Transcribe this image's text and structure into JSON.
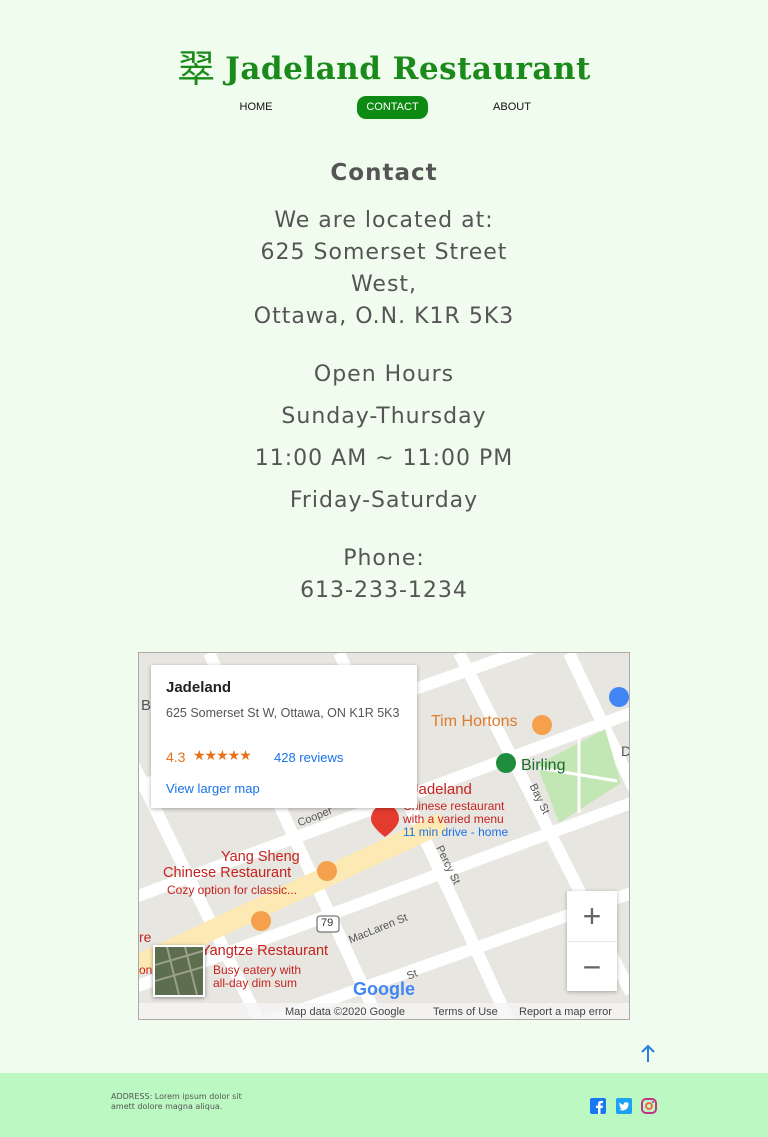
{
  "brand": {
    "logo_glyph": "翠",
    "name": "Jadeland Restaurant",
    "color": "#1a8a1a"
  },
  "nav": {
    "home": "HOME",
    "contact": "CONTACT",
    "about": "ABOUT",
    "active_color": "#0d8a12"
  },
  "contact": {
    "heading": "Contact",
    "located_intro": "We are located at:",
    "street_line1": "625 Somerset Street",
    "street_line2": "West,",
    "city_line": "Ottawa, O.N. K1R 5K3"
  },
  "hours": {
    "title": "Open Hours",
    "days1": "Sunday-Thursday",
    "time1": "11:00 AM ~ 11:00 PM",
    "days2": "Friday-Saturday"
  },
  "phone": {
    "label": "Phone:",
    "number": "613-233-1234"
  },
  "map": {
    "card_name": "Jadeland",
    "card_address": "625 Somerset St W, Ottawa, ON K1R 5K3",
    "rating": "4.3",
    "stars": "★★★★★",
    "reviews": "428 reviews",
    "larger_map": "View larger map",
    "poi_tim": "Tim Hortons",
    "poi_birling": "Birling",
    "poi_jadeland": "Jadeland",
    "poi_jadeland_desc1": "Chinese restaurant",
    "poi_jadeland_desc2": "with a varied menu",
    "poi_jadeland_drive": "11 min drive - home",
    "poi_yang1": "Yang Sheng",
    "poi_yang2": "Chinese Restaurant",
    "poi_yang_desc": "Cozy option for classic...",
    "poi_yangtze": "Yangtze Restaurant",
    "poi_yangtze_desc1": "Busy eatery with",
    "poi_yangtze_desc2": "all-day dim sum",
    "street_cooper": "Cooper",
    "street_percy": "Percy St",
    "street_maclaren": "MacLaren St",
    "street_bay": "Bay St",
    "street_gilmour": "St",
    "route_79": "79",
    "edge_b": "B",
    "edge_re": "re",
    "edge_on": "on",
    "edge_d": "D",
    "zoom_in": "+",
    "zoom_out": "−",
    "google": "Google",
    "map_data": "Map data ©2020 Google",
    "terms": "Terms of Use",
    "report": "Report a map error"
  },
  "footer": {
    "address": "ADDRESS: Lorem ipsum dolor sit amett dolore magna aliqua.",
    "social": [
      "facebook-icon",
      "twitter-icon",
      "instagram-icon"
    ],
    "bg_color": "#bcf9c2"
  }
}
